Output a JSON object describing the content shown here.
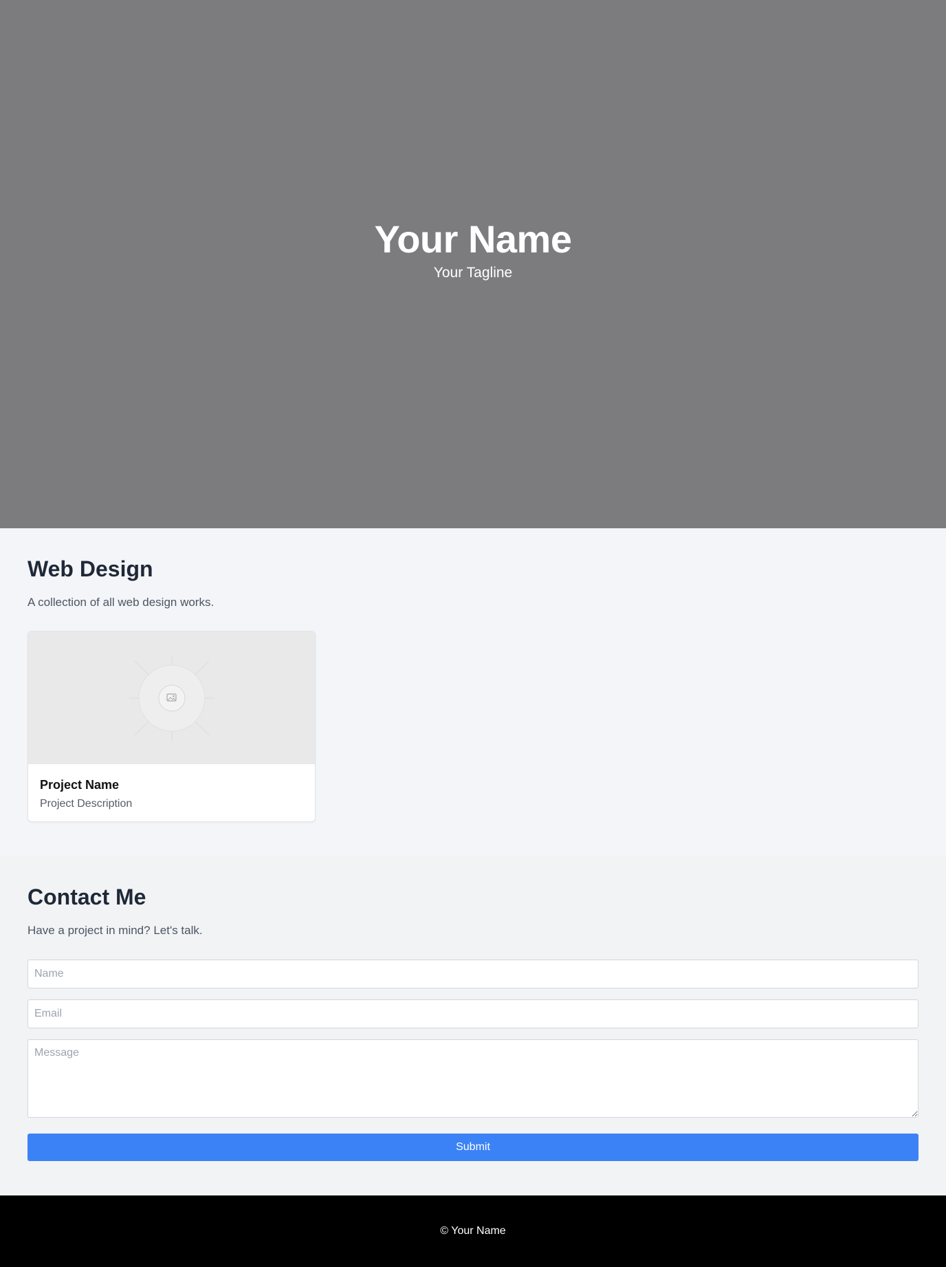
{
  "hero": {
    "title": "Your Name",
    "tagline": "Your Tagline",
    "background_color": "#7c7c7e"
  },
  "portfolio": {
    "title": "Web Design",
    "subtitle": "A collection of all web design works.",
    "projects": [
      {
        "name": "Project Name",
        "description": "Project Description",
        "image_icon": "image-placeholder-icon"
      }
    ]
  },
  "contact": {
    "title": "Contact Me",
    "subtitle": "Have a project in mind? Let's talk.",
    "name_placeholder": "Name",
    "email_placeholder": "Email",
    "message_placeholder": "Message",
    "submit_label": "Submit",
    "accent_color": "#3b82f6"
  },
  "footer": {
    "text": "© Your Name"
  }
}
